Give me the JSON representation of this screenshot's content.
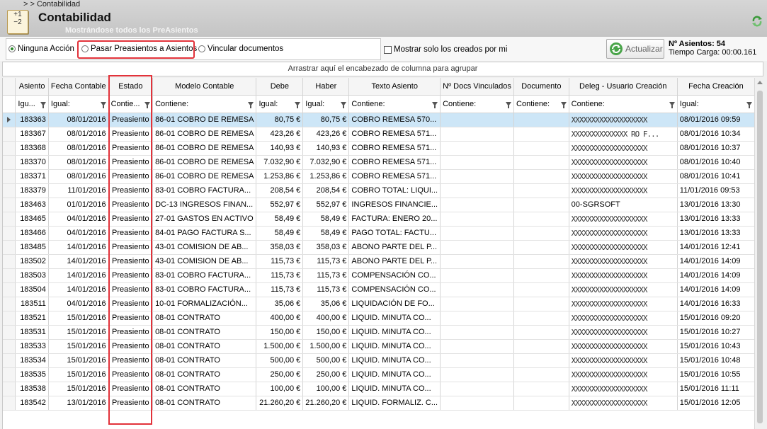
{
  "header": {
    "breadcrumb": ">  > Contabilidad",
    "title": "Contabilidad",
    "subtitle": "Mostrándose todos los PreAsientos",
    "icon_top": "+1",
    "icon_bottom": "−2"
  },
  "actions": {
    "radio_none": "Ninguna Acción",
    "radio_pass": "Pasar Preasientos a Asientos",
    "radio_link": "Vincular documentos",
    "selected": "Ninguna Acción",
    "checkbox_label": "Mostrar solo los creados por mi",
    "update_label": "Actualizar"
  },
  "stats": {
    "count_label": "Nº Asientos: 54",
    "time_label": "Tiempo Carga: 00:00.161"
  },
  "group_panel": "Arrastrar aquí el encabezado de columna para agrupar",
  "columns": [
    "Asiento",
    "Fecha Contable",
    "Estado",
    "Modelo Contable",
    "Debe",
    "Haber",
    "Texto Asiento",
    "Nº Docs Vinculados",
    "Documento",
    "Deleg - Usuario Creación",
    "Fecha Creación"
  ],
  "filters": [
    "Igu...",
    "Igual:",
    "Contie...",
    "Contiene:",
    "Igual:",
    "Igual:",
    "Contiene:",
    "Contiene:",
    "Contiene:",
    "Contiene:",
    "Igual:"
  ],
  "rows": [
    [
      "183363",
      "08/01/2016",
      "Preasiento",
      "86-01   COBRO DE REMESA",
      "80,75 €",
      "80,75 €",
      "COBRO REMESA 570...",
      "",
      "",
      "XXXXXXXXXXXXXXXXXXX",
      "08/01/2016 09:59"
    ],
    [
      "183367",
      "08/01/2016",
      "Preasiento",
      "86-01   COBRO DE REMESA",
      "423,26 €",
      "423,26 €",
      "COBRO REMESA 571...",
      "",
      "",
      "XXXXXXXXXXXXXX RO F...",
      "08/01/2016 10:34"
    ],
    [
      "183368",
      "08/01/2016",
      "Preasiento",
      "86-01   COBRO DE REMESA",
      "140,93 €",
      "140,93 €",
      "COBRO REMESA 571...",
      "",
      "",
      "XXXXXXXXXXXXXXXXXXX",
      "08/01/2016 10:37"
    ],
    [
      "183370",
      "08/01/2016",
      "Preasiento",
      "86-01   COBRO DE REMESA",
      "7.032,90 €",
      "7.032,90 €",
      "COBRO REMESA 571...",
      "",
      "",
      "XXXXXXXXXXXXXXXXXXX",
      "08/01/2016 10:40"
    ],
    [
      "183371",
      "08/01/2016",
      "Preasiento",
      "86-01   COBRO DE REMESA",
      "1.253,86 €",
      "1.253,86 €",
      "COBRO REMESA 571...",
      "",
      "",
      "XXXXXXXXXXXXXXXXXXX",
      "08/01/2016 10:41"
    ],
    [
      "183379",
      "11/01/2016",
      "Preasiento",
      "83-01   COBRO FACTURA...",
      "208,54 €",
      "208,54 €",
      "COBRO TOTAL: LIQUI...",
      "",
      "",
      "XXXXXXXXXXXXXXXXXXX",
      "11/01/2016 09:53"
    ],
    [
      "183463",
      "01/01/2016",
      "Preasiento",
      "DC-13   INGRESOS FINAN...",
      "552,97 €",
      "552,97 €",
      "INGRESOS FINANCIE...",
      "",
      "",
      "00-SGRSOFT",
      "13/01/2016 13:30"
    ],
    [
      "183465",
      "04/01/2016",
      "Preasiento",
      "27-01   GASTOS EN ACTIVO",
      "58,49 €",
      "58,49 €",
      "FACTURA: ENERO 20...",
      "",
      "",
      "XXXXXXXXXXXXXXXXXXX",
      "13/01/2016 13:33"
    ],
    [
      "183466",
      "04/01/2016",
      "Preasiento",
      "84-01   PAGO FACTURA S...",
      "58,49 €",
      "58,49 €",
      "PAGO TOTAL: FACTU...",
      "",
      "",
      "XXXXXXXXXXXXXXXXXXX",
      "13/01/2016 13:33"
    ],
    [
      "183485",
      "14/01/2016",
      "Preasiento",
      "43-01   COMISION DE AB...",
      "358,03 €",
      "358,03 €",
      "ABONO PARTE DEL P...",
      "",
      "",
      "XXXXXXXXXXXXXXXXXXX",
      "14/01/2016 12:41"
    ],
    [
      "183502",
      "14/01/2016",
      "Preasiento",
      "43-01   COMISION DE AB...",
      "115,73 €",
      "115,73 €",
      "ABONO PARTE DEL P...",
      "",
      "",
      "XXXXXXXXXXXXXXXXXXX",
      "14/01/2016 14:09"
    ],
    [
      "183503",
      "14/01/2016",
      "Preasiento",
      "83-01   COBRO FACTURA...",
      "115,73 €",
      "115,73 €",
      "COMPENSACIÓN  CO...",
      "",
      "",
      "XXXXXXXXXXXXXXXXXXX",
      "14/01/2016 14:09"
    ],
    [
      "183504",
      "14/01/2016",
      "Preasiento",
      "83-01   COBRO FACTURA...",
      "115,73 €",
      "115,73 €",
      "COMPENSACIÓN  CO...",
      "",
      "",
      "XXXXXXXXXXXXXXXXXXX",
      "14/01/2016 14:09"
    ],
    [
      "183511",
      "04/01/2016",
      "Preasiento",
      "10-01   FORMALIZACIÓN...",
      "35,06 €",
      "35,06 €",
      "LIQUIDACIÓN  DE FO...",
      "",
      "",
      "XXXXXXXXXXXXXXXXXXX",
      "14/01/2016 16:33"
    ],
    [
      "183521",
      "15/01/2016",
      "Preasiento",
      "08-01   CONTRATO",
      "400,00 €",
      "400,00 €",
      "LIQUID. MINUTA CO...",
      "",
      "",
      "XXXXXXXXXXXXXXXXXXX",
      "15/01/2016 09:20"
    ],
    [
      "183531",
      "15/01/2016",
      "Preasiento",
      "08-01   CONTRATO",
      "150,00 €",
      "150,00 €",
      "LIQUID. MINUTA CO...",
      "",
      "",
      "XXXXXXXXXXXXXXXXXXX",
      "15/01/2016 10:27"
    ],
    [
      "183533",
      "15/01/2016",
      "Preasiento",
      "08-01   CONTRATO",
      "1.500,00 €",
      "1.500,00 €",
      "LIQUID. MINUTA CO...",
      "",
      "",
      "XXXXXXXXXXXXXXXXXXX",
      "15/01/2016 10:43"
    ],
    [
      "183534",
      "15/01/2016",
      "Preasiento",
      "08-01   CONTRATO",
      "500,00 €",
      "500,00 €",
      "LIQUID. MINUTA CO...",
      "",
      "",
      "XXXXXXXXXXXXXXXXXXX",
      "15/01/2016 10:48"
    ],
    [
      "183535",
      "15/01/2016",
      "Preasiento",
      "08-01   CONTRATO",
      "250,00 €",
      "250,00 €",
      "LIQUID. MINUTA CO...",
      "",
      "",
      "XXXXXXXXXXXXXXXXXXX",
      "15/01/2016 10:55"
    ],
    [
      "183538",
      "15/01/2016",
      "Preasiento",
      "08-01   CONTRATO",
      "100,00 €",
      "100,00 €",
      "LIQUID. MINUTA CO...",
      "",
      "",
      "XXXXXXXXXXXXXXXXXXX",
      "15/01/2016 11:11"
    ],
    [
      "183542",
      "13/01/2016",
      "Preasiento",
      "08-01   CONTRATO",
      "21.260,20 €",
      "21.260,20 €",
      "LIQUID. FORMALIZ. C...",
      "",
      "",
      "XXXXXXXXXXXXXXXXXXX",
      "15/01/2016 12:05"
    ]
  ],
  "colors": {
    "highlight": "#e2323a",
    "selected_row": "#cde6f7",
    "accent_green": "#2a8a2a"
  },
  "icons": [
    "document-plus-minus-icon",
    "refresh-icon",
    "funnel-icon",
    "row-indicator-arrow-icon"
  ]
}
